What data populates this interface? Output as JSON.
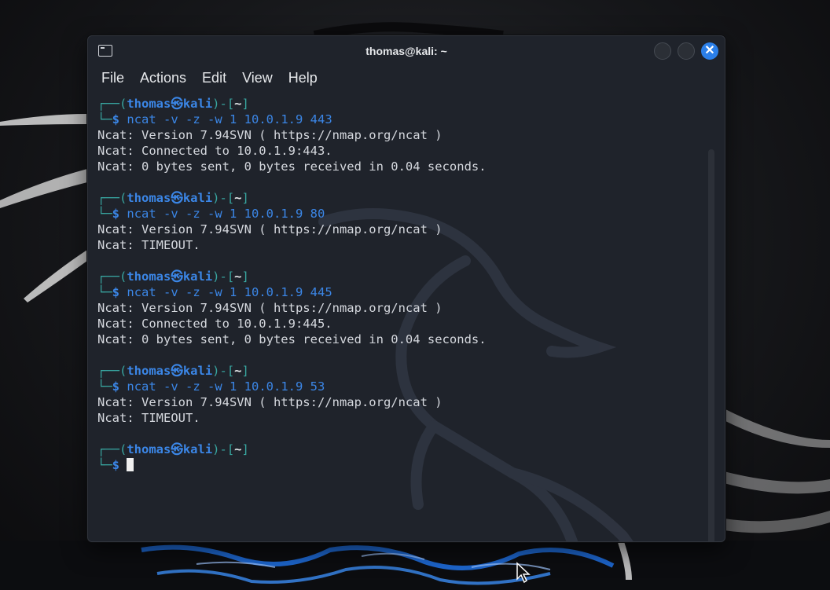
{
  "window": {
    "title": "thomas@kali: ~",
    "close_glyph": "✕"
  },
  "menu": [
    "File",
    "Actions",
    "Edit",
    "View",
    "Help"
  ],
  "prompt": {
    "user": "thomas",
    "at_symbol": "㉿",
    "host": "kali",
    "dir": "~",
    "corner_top": "┌──(",
    "sep_open": ")-[",
    "sep_close": "]",
    "corner_bottom": "└─",
    "dollar": "$"
  },
  "blocks": [
    {
      "command": "ncat -v -z -w 1 10.0.1.9 443",
      "output": [
        "Ncat: Version 7.94SVN ( https://nmap.org/ncat )",
        "Ncat: Connected to 10.0.1.9:443.",
        "Ncat: 0 bytes sent, 0 bytes received in 0.04 seconds."
      ]
    },
    {
      "command": "ncat -v -z -w 1 10.0.1.9 80",
      "output": [
        "Ncat: Version 7.94SVN ( https://nmap.org/ncat )",
        "Ncat: TIMEOUT."
      ]
    },
    {
      "command": "ncat -v -z -w 1 10.0.1.9 445",
      "output": [
        "Ncat: Version 7.94SVN ( https://nmap.org/ncat )",
        "Ncat: Connected to 10.0.1.9:445.",
        "Ncat: 0 bytes sent, 0 bytes received in 0.04 seconds."
      ]
    },
    {
      "command": "ncat -v -z -w 1 10.0.1.9 53",
      "output": [
        "Ncat: Version 7.94SVN ( https://nmap.org/ncat )",
        "Ncat: TIMEOUT."
      ]
    }
  ],
  "colors": {
    "accent": "#2b7fe8",
    "prompt_frame": "#38a6a0",
    "prompt_user": "#3b86e6",
    "terminal_bg": "#1f232b"
  },
  "icons": {
    "app": "terminal-icon",
    "close": "close-icon",
    "pointer": "mouse-pointer-icon"
  }
}
